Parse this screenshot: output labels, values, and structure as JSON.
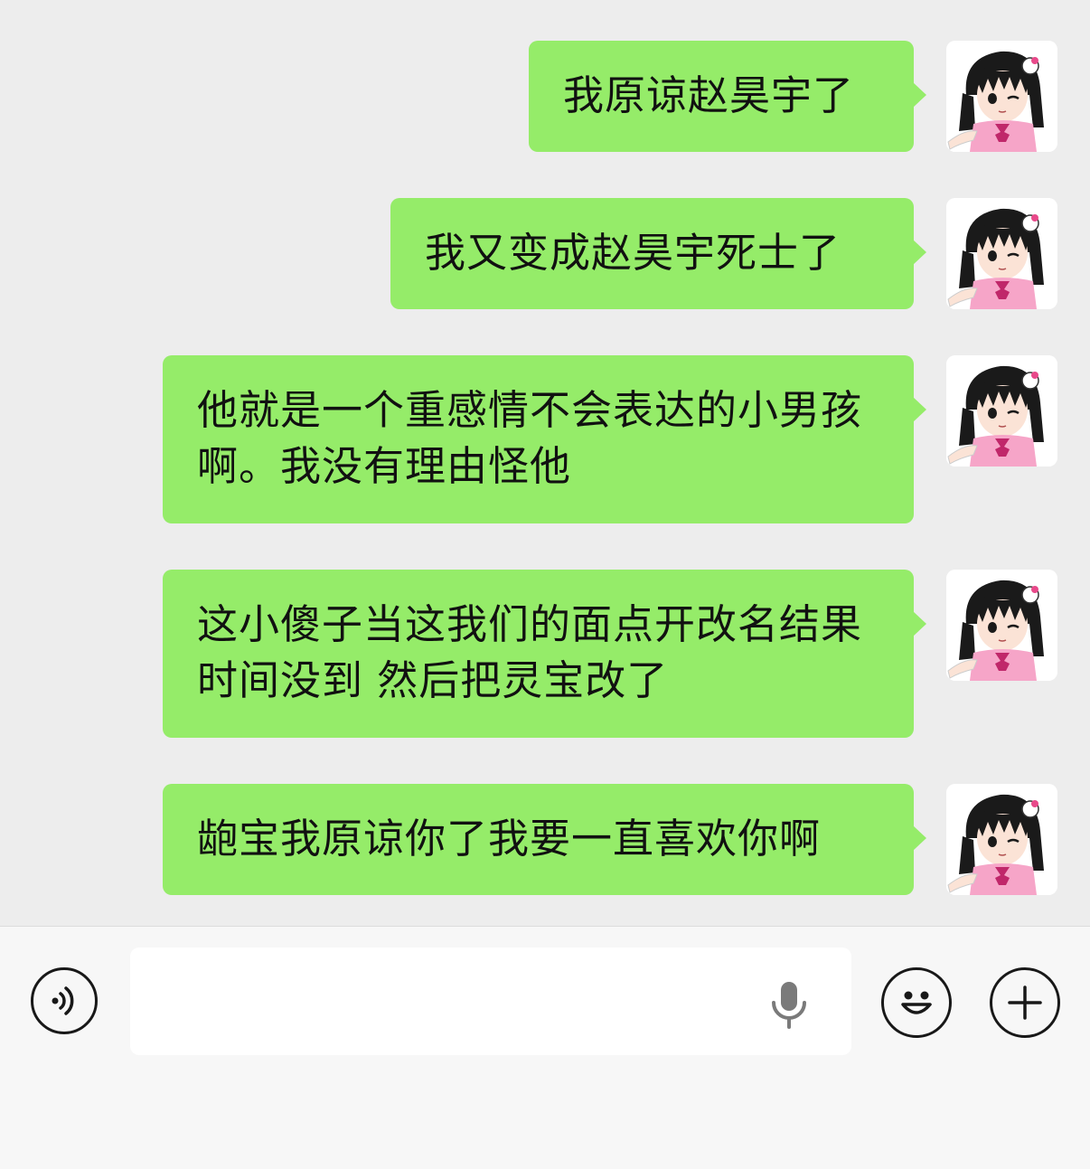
{
  "messages": [
    {
      "text": "我原谅赵昊宇了"
    },
    {
      "text": "我又变成赵昊宇死士了"
    },
    {
      "text": "他就是一个重感情不会表达的小男孩啊。我没有理由怪他"
    },
    {
      "text": "这小傻子当这我们的面点开改名结果时间没到 然后把灵宝改了"
    },
    {
      "text": "龅宝我原谅你了我要一直喜欢你啊"
    }
  ],
  "input": {
    "value": "",
    "placeholder": ""
  },
  "icons": {
    "voice": "voice-toggle-icon",
    "mic": "microphone-icon",
    "emoji": "emoji-icon",
    "plus": "plus-icon",
    "avatar": "avatar-anime-girl"
  },
  "colors": {
    "bubble": "#95ec69",
    "chat_bg": "#ededed",
    "input_bar_bg": "#f7f7f7",
    "input_bg": "#ffffff",
    "icon": "#181818"
  }
}
